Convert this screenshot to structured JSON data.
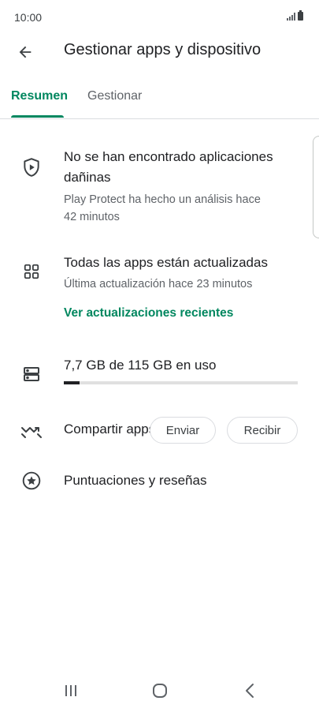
{
  "status_bar": {
    "time": "10:00",
    "signal_icon": "signal-icon",
    "battery_icon": "battery-icon"
  },
  "header": {
    "back_icon": "arrow-left-icon",
    "title": "Gestionar apps y dispositivo"
  },
  "tabs": [
    {
      "label": "Resumen",
      "selected": true
    },
    {
      "label": "Gestionar",
      "selected": false
    }
  ],
  "accent_color": "#01875f",
  "play_protect": {
    "icon": "shield-play-icon",
    "title_line1": "No se han encontrado aplicaciones",
    "title_line2": "dañinas",
    "sub_line1": "Play Protect ha hecho un análisis hace",
    "sub_line2": "42 minutos"
  },
  "updates": {
    "icon": "apps-grid-icon",
    "title": "Todas las apps están actualizadas",
    "subtitle": "Última actualización hace 23 minutos",
    "link": "Ver actualizaciones recientes"
  },
  "storage": {
    "icon": "storage-icon",
    "label": "7,7 GB de 115 GB en uso",
    "used_fraction": 0.067
  },
  "share": {
    "icon": "share-apps-icon",
    "label": "Compartir apps",
    "send_label": "Enviar",
    "receive_label": "Recibir"
  },
  "ratings": {
    "icon": "star-circle-icon",
    "label": "Puntuaciones y reseñas"
  },
  "navbar": {
    "recents_icon": "recents-icon",
    "home_icon": "home-icon",
    "back_icon": "back-chevron-icon"
  }
}
